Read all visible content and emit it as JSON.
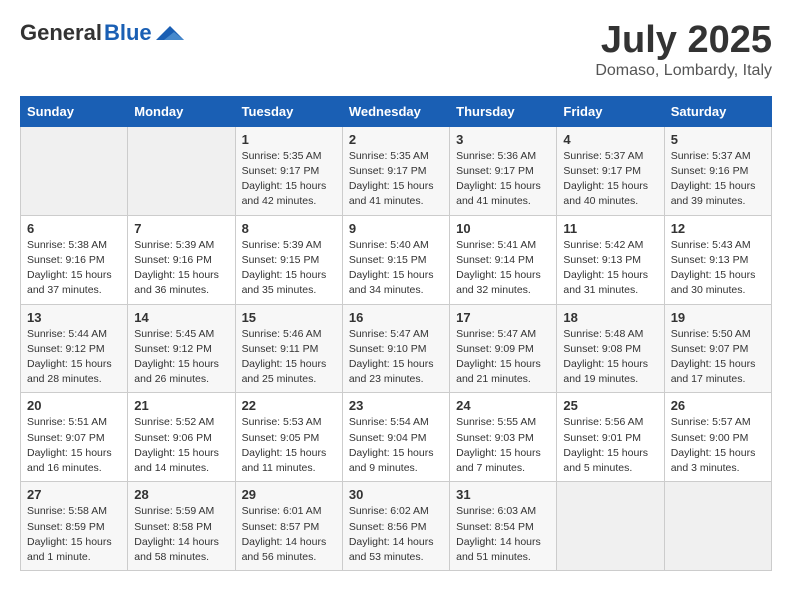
{
  "header": {
    "logo_general": "General",
    "logo_blue": "Blue",
    "month_year": "July 2025",
    "location": "Domaso, Lombardy, Italy"
  },
  "days_of_week": [
    "Sunday",
    "Monday",
    "Tuesday",
    "Wednesday",
    "Thursday",
    "Friday",
    "Saturday"
  ],
  "weeks": [
    [
      {
        "day": "",
        "sunrise": "",
        "sunset": "",
        "daylight": ""
      },
      {
        "day": "",
        "sunrise": "",
        "sunset": "",
        "daylight": ""
      },
      {
        "day": "1",
        "sunrise": "Sunrise: 5:35 AM",
        "sunset": "Sunset: 9:17 PM",
        "daylight": "Daylight: 15 hours and 42 minutes."
      },
      {
        "day": "2",
        "sunrise": "Sunrise: 5:35 AM",
        "sunset": "Sunset: 9:17 PM",
        "daylight": "Daylight: 15 hours and 41 minutes."
      },
      {
        "day": "3",
        "sunrise": "Sunrise: 5:36 AM",
        "sunset": "Sunset: 9:17 PM",
        "daylight": "Daylight: 15 hours and 41 minutes."
      },
      {
        "day": "4",
        "sunrise": "Sunrise: 5:37 AM",
        "sunset": "Sunset: 9:17 PM",
        "daylight": "Daylight: 15 hours and 40 minutes."
      },
      {
        "day": "5",
        "sunrise": "Sunrise: 5:37 AM",
        "sunset": "Sunset: 9:16 PM",
        "daylight": "Daylight: 15 hours and 39 minutes."
      }
    ],
    [
      {
        "day": "6",
        "sunrise": "Sunrise: 5:38 AM",
        "sunset": "Sunset: 9:16 PM",
        "daylight": "Daylight: 15 hours and 37 minutes."
      },
      {
        "day": "7",
        "sunrise": "Sunrise: 5:39 AM",
        "sunset": "Sunset: 9:16 PM",
        "daylight": "Daylight: 15 hours and 36 minutes."
      },
      {
        "day": "8",
        "sunrise": "Sunrise: 5:39 AM",
        "sunset": "Sunset: 9:15 PM",
        "daylight": "Daylight: 15 hours and 35 minutes."
      },
      {
        "day": "9",
        "sunrise": "Sunrise: 5:40 AM",
        "sunset": "Sunset: 9:15 PM",
        "daylight": "Daylight: 15 hours and 34 minutes."
      },
      {
        "day": "10",
        "sunrise": "Sunrise: 5:41 AM",
        "sunset": "Sunset: 9:14 PM",
        "daylight": "Daylight: 15 hours and 32 minutes."
      },
      {
        "day": "11",
        "sunrise": "Sunrise: 5:42 AM",
        "sunset": "Sunset: 9:13 PM",
        "daylight": "Daylight: 15 hours and 31 minutes."
      },
      {
        "day": "12",
        "sunrise": "Sunrise: 5:43 AM",
        "sunset": "Sunset: 9:13 PM",
        "daylight": "Daylight: 15 hours and 30 minutes."
      }
    ],
    [
      {
        "day": "13",
        "sunrise": "Sunrise: 5:44 AM",
        "sunset": "Sunset: 9:12 PM",
        "daylight": "Daylight: 15 hours and 28 minutes."
      },
      {
        "day": "14",
        "sunrise": "Sunrise: 5:45 AM",
        "sunset": "Sunset: 9:12 PM",
        "daylight": "Daylight: 15 hours and 26 minutes."
      },
      {
        "day": "15",
        "sunrise": "Sunrise: 5:46 AM",
        "sunset": "Sunset: 9:11 PM",
        "daylight": "Daylight: 15 hours and 25 minutes."
      },
      {
        "day": "16",
        "sunrise": "Sunrise: 5:47 AM",
        "sunset": "Sunset: 9:10 PM",
        "daylight": "Daylight: 15 hours and 23 minutes."
      },
      {
        "day": "17",
        "sunrise": "Sunrise: 5:47 AM",
        "sunset": "Sunset: 9:09 PM",
        "daylight": "Daylight: 15 hours and 21 minutes."
      },
      {
        "day": "18",
        "sunrise": "Sunrise: 5:48 AM",
        "sunset": "Sunset: 9:08 PM",
        "daylight": "Daylight: 15 hours and 19 minutes."
      },
      {
        "day": "19",
        "sunrise": "Sunrise: 5:50 AM",
        "sunset": "Sunset: 9:07 PM",
        "daylight": "Daylight: 15 hours and 17 minutes."
      }
    ],
    [
      {
        "day": "20",
        "sunrise": "Sunrise: 5:51 AM",
        "sunset": "Sunset: 9:07 PM",
        "daylight": "Daylight: 15 hours and 16 minutes."
      },
      {
        "day": "21",
        "sunrise": "Sunrise: 5:52 AM",
        "sunset": "Sunset: 9:06 PM",
        "daylight": "Daylight: 15 hours and 14 minutes."
      },
      {
        "day": "22",
        "sunrise": "Sunrise: 5:53 AM",
        "sunset": "Sunset: 9:05 PM",
        "daylight": "Daylight: 15 hours and 11 minutes."
      },
      {
        "day": "23",
        "sunrise": "Sunrise: 5:54 AM",
        "sunset": "Sunset: 9:04 PM",
        "daylight": "Daylight: 15 hours and 9 minutes."
      },
      {
        "day": "24",
        "sunrise": "Sunrise: 5:55 AM",
        "sunset": "Sunset: 9:03 PM",
        "daylight": "Daylight: 15 hours and 7 minutes."
      },
      {
        "day": "25",
        "sunrise": "Sunrise: 5:56 AM",
        "sunset": "Sunset: 9:01 PM",
        "daylight": "Daylight: 15 hours and 5 minutes."
      },
      {
        "day": "26",
        "sunrise": "Sunrise: 5:57 AM",
        "sunset": "Sunset: 9:00 PM",
        "daylight": "Daylight: 15 hours and 3 minutes."
      }
    ],
    [
      {
        "day": "27",
        "sunrise": "Sunrise: 5:58 AM",
        "sunset": "Sunset: 8:59 PM",
        "daylight": "Daylight: 15 hours and 1 minute."
      },
      {
        "day": "28",
        "sunrise": "Sunrise: 5:59 AM",
        "sunset": "Sunset: 8:58 PM",
        "daylight": "Daylight: 14 hours and 58 minutes."
      },
      {
        "day": "29",
        "sunrise": "Sunrise: 6:01 AM",
        "sunset": "Sunset: 8:57 PM",
        "daylight": "Daylight: 14 hours and 56 minutes."
      },
      {
        "day": "30",
        "sunrise": "Sunrise: 6:02 AM",
        "sunset": "Sunset: 8:56 PM",
        "daylight": "Daylight: 14 hours and 53 minutes."
      },
      {
        "day": "31",
        "sunrise": "Sunrise: 6:03 AM",
        "sunset": "Sunset: 8:54 PM",
        "daylight": "Daylight: 14 hours and 51 minutes."
      },
      {
        "day": "",
        "sunrise": "",
        "sunset": "",
        "daylight": ""
      },
      {
        "day": "",
        "sunrise": "",
        "sunset": "",
        "daylight": ""
      }
    ]
  ]
}
